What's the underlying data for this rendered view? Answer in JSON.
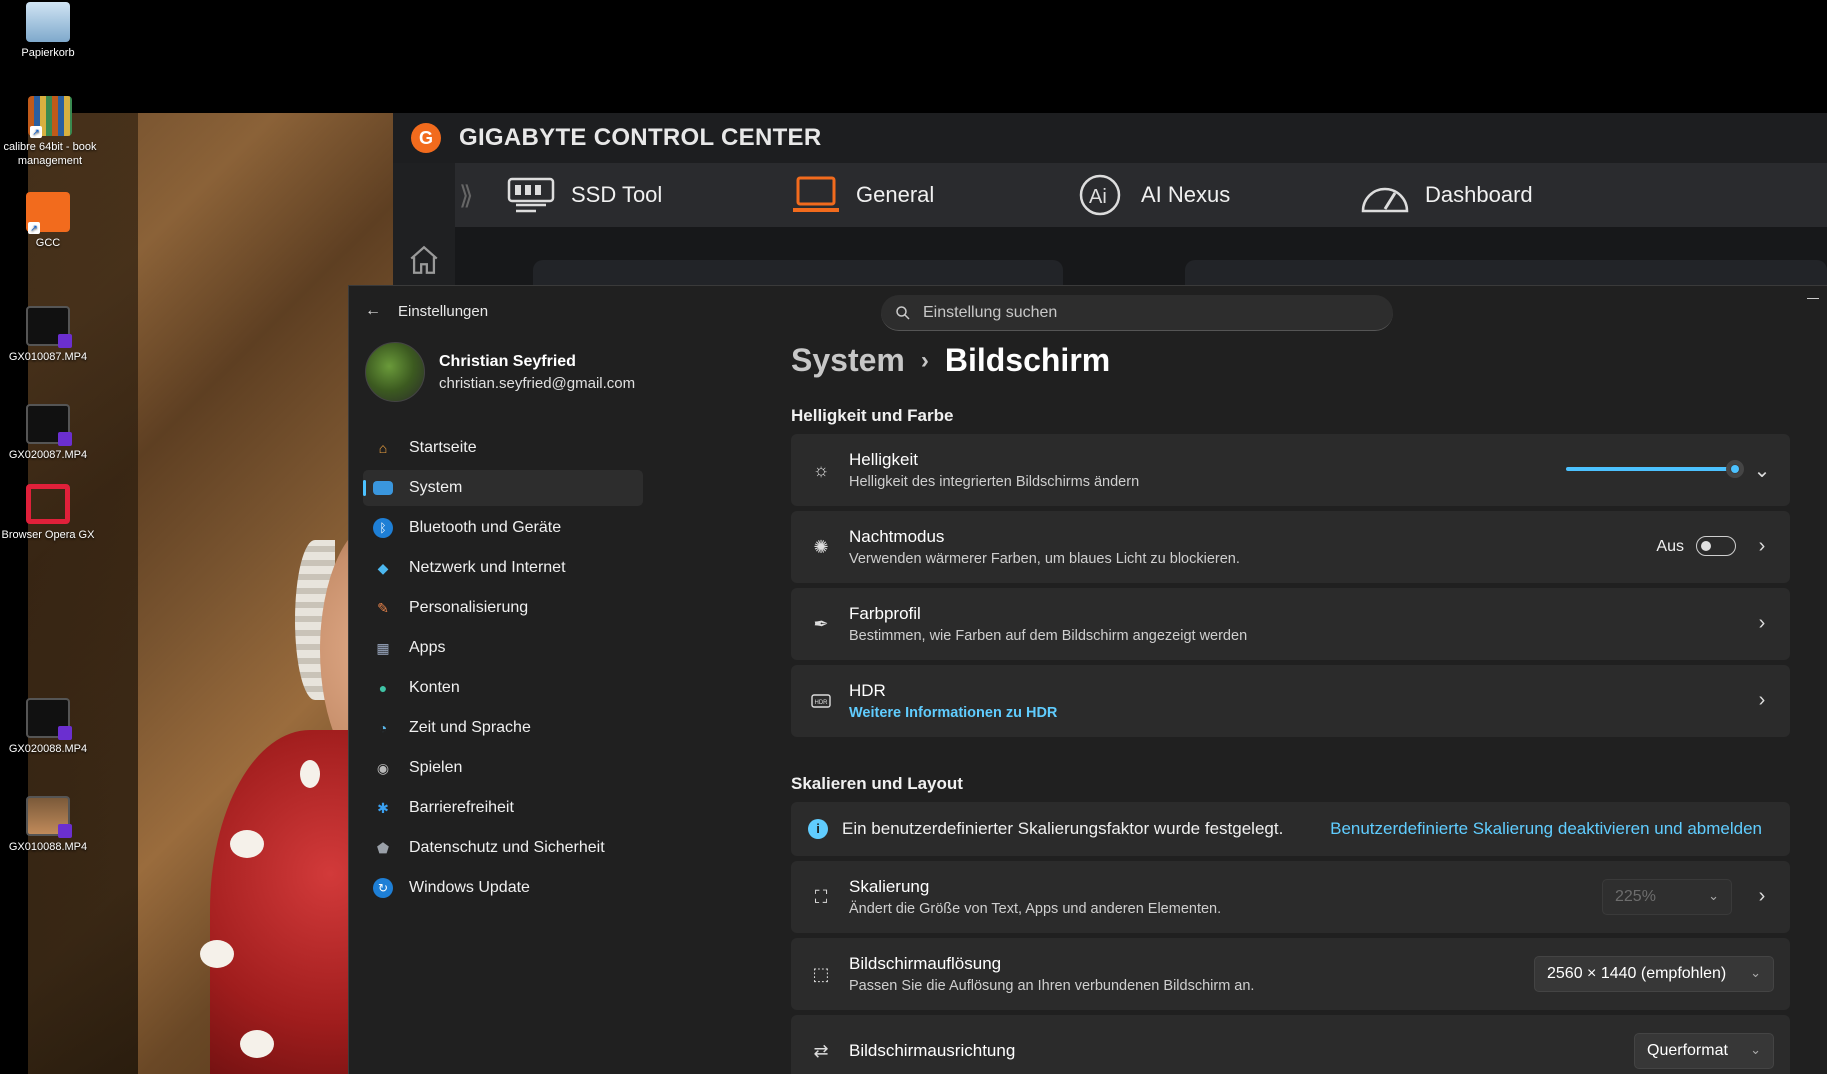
{
  "desktop": {
    "icons": [
      {
        "label": "Papierkorb"
      },
      {
        "label": "calibre 64bit - book management"
      },
      {
        "label": "GCC"
      },
      {
        "label": "GX010087.MP4"
      },
      {
        "label": "GX020087.MP4"
      },
      {
        "label": "Browser Opera GX"
      },
      {
        "label": "GX020088.MP4"
      },
      {
        "label": "GX010088.MP4"
      }
    ]
  },
  "gcc": {
    "title": "GIGABYTE CONTROL CENTER",
    "tabs": [
      {
        "label": "SSD Tool",
        "icon": "ssd-icon"
      },
      {
        "label": "General",
        "icon": "laptop-icon"
      },
      {
        "label": "AI Nexus",
        "icon": "ai-icon"
      },
      {
        "label": "Dashboard",
        "icon": "gauge-icon"
      }
    ],
    "accent": "#f26b1d"
  },
  "settings": {
    "app_title": "Einstellungen",
    "search_placeholder": "Einstellung suchen",
    "profile": {
      "name": "Christian Seyfried",
      "email": "christian.seyfried@gmail.com"
    },
    "nav": [
      {
        "label": "Startseite",
        "icon": "home-icon"
      },
      {
        "label": "System",
        "icon": "monitor-icon",
        "active": true
      },
      {
        "label": "Bluetooth und Geräte",
        "icon": "bluetooth-icon"
      },
      {
        "label": "Netzwerk und Internet",
        "icon": "wifi-icon"
      },
      {
        "label": "Personalisierung",
        "icon": "brush-icon"
      },
      {
        "label": "Apps",
        "icon": "apps-icon"
      },
      {
        "label": "Konten",
        "icon": "person-icon"
      },
      {
        "label": "Zeit und Sprache",
        "icon": "clock-globe-icon"
      },
      {
        "label": "Spielen",
        "icon": "gamepad-icon"
      },
      {
        "label": "Barrierefreiheit",
        "icon": "accessibility-icon"
      },
      {
        "label": "Datenschutz und Sicherheit",
        "icon": "shield-icon"
      },
      {
        "label": "Windows Update",
        "icon": "update-icon"
      }
    ],
    "breadcrumb": {
      "parent": "System",
      "separator": "›",
      "current": "Bildschirm"
    },
    "sections": {
      "brightness_color": "Helligkeit und Farbe",
      "scale_layout": "Skalieren und Layout"
    },
    "cards": {
      "brightness": {
        "title": "Helligkeit",
        "subtitle": "Helligkeit des integrierten Bildschirms ändern",
        "level": 0.95
      },
      "night": {
        "title": "Nachtmodus",
        "subtitle": "Verwenden wärmerer Farben, um blaues Licht zu blockieren.",
        "state": "Aus"
      },
      "profile": {
        "title": "Farbprofil",
        "subtitle": "Bestimmen, wie Farben auf dem Bildschirm angezeigt werden"
      },
      "hdr": {
        "title": "HDR",
        "subtitle": "Weitere Informationen zu HDR"
      },
      "info": {
        "text": "Ein benutzerdefinierter Skalierungsfaktor wurde festgelegt.",
        "link": "Benutzerdefinierte Skalierung deaktivieren und abmelden"
      },
      "scaling": {
        "title": "Skalierung",
        "subtitle": "Ändert die Größe von Text, Apps und anderen Elementen.",
        "value": "225%"
      },
      "resolution": {
        "title": "Bildschirmauflösung",
        "subtitle": "Passen Sie die Auflösung an Ihren verbundenen Bildschirm an.",
        "value": "2560 × 1440 (empfohlen)"
      },
      "orientation": {
        "title": "Bildschirmausrichtung",
        "value": "Querformat"
      }
    },
    "accent": "#4cc2ff"
  }
}
